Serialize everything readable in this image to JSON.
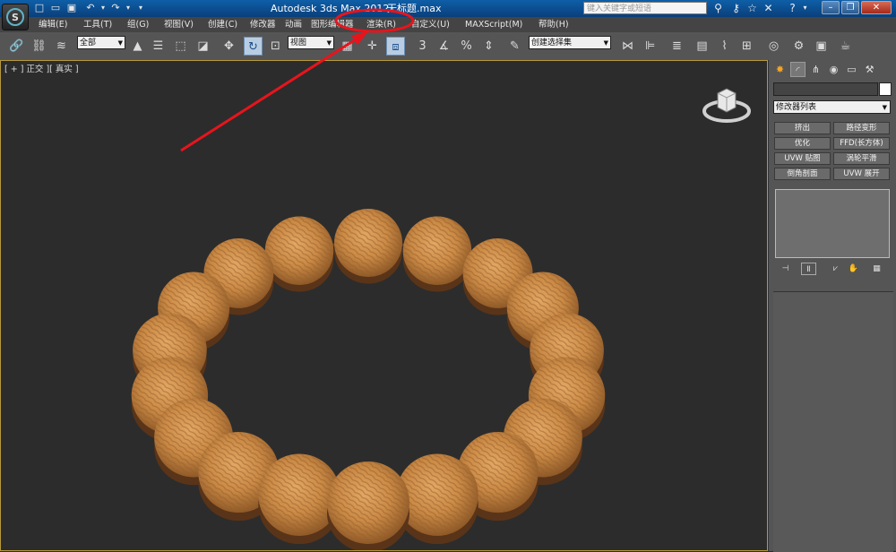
{
  "title_bar": {
    "app_title": "Autodesk 3ds Max  2012",
    "file_name": "无标题.max",
    "search_placeholder": "键入关键字或短语",
    "icons": [
      "binoculars-icon",
      "key-icon",
      "star-icon",
      "close-icon",
      "help-icon"
    ],
    "window_buttons": {
      "minimize": "–",
      "restore": "❐",
      "close": "✕"
    }
  },
  "menu": {
    "items": [
      "编辑(E)",
      "工具(T)",
      "组(G)",
      "视图(V)",
      "创建(C)",
      "修改器",
      "动画",
      "图形编辑器",
      "渲染(R)",
      "自定义(U)",
      "MAXScript(M)",
      "帮助(H)"
    ]
  },
  "toolbar": {
    "selection_filter": "全部",
    "reference_coord": "视图",
    "named_selection_set": "创建选择集",
    "snap_label": "3",
    "percent_label": "%"
  },
  "viewport": {
    "label": "[ + ] 正交 ][ 真实 ]",
    "border_color": "#b89a3a",
    "background_color": "#2c2c2c",
    "object": "bead-bracelet",
    "bead_count": 18,
    "bead_color": "#c98a45"
  },
  "command_panel": {
    "modifier_list": "修改器列表",
    "buttons": [
      [
        "挤出",
        "路径变形"
      ],
      [
        "优化",
        "FFD(长方体)"
      ],
      [
        "UVW 贴图",
        "涡轮平滑"
      ],
      [
        "倒角剖面",
        "UVW 展开"
      ]
    ]
  },
  "annotation": {
    "highlighted_menu": "渲染(R)",
    "color": "#e8141c"
  }
}
